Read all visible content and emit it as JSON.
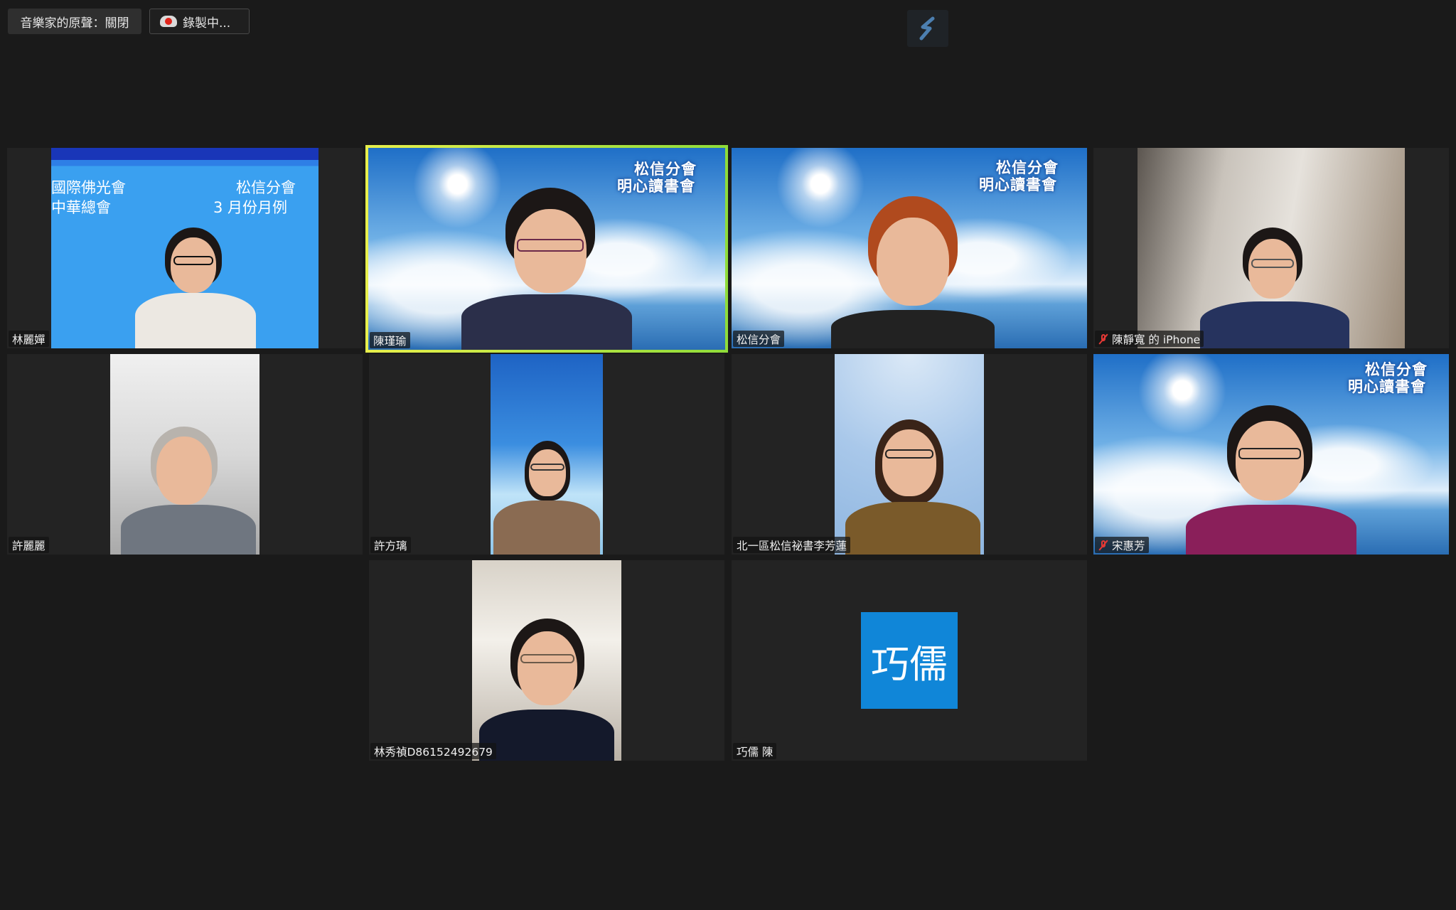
{
  "topbar": {
    "music_mode_label": "音樂家的原聲：關閉",
    "recording_label": "錄製中..."
  },
  "gallery": {
    "tiles": [
      {
        "name": "林麗嬋",
        "muted": false,
        "slide_lines": [
          "國際佛光會",
          "中華總會",
          "松信分會",
          "3 月份月例"
        ]
      },
      {
        "name": "陳瑾瑜",
        "muted": false,
        "active_speaker": true,
        "slide_lines": [
          "松信分會",
          "明心讀書會"
        ]
      },
      {
        "name": "松信分會",
        "muted": false,
        "slide_lines": [
          "松信分會",
          "明心讀書會"
        ]
      },
      {
        "name": "陳靜寬 的 iPhone",
        "muted": true
      },
      {
        "name": "許麗麗",
        "muted": false
      },
      {
        "name": "許方璃",
        "muted": false
      },
      {
        "name": "北一區松信祕書李芳蓮",
        "muted": false
      },
      {
        "name": "宋惠芳",
        "muted": true,
        "slide_lines": [
          "松信分會",
          "明心讀書會"
        ]
      },
      {
        "name": "林秀禎D86152492679",
        "muted": false
      },
      {
        "name": "巧儒 陳",
        "muted": false,
        "avatar_text": "巧儒"
      }
    ]
  },
  "colors": {
    "background": "#1a1a1a",
    "active_speaker_border": "#c6e84a",
    "avatar_blue": "#1086d8",
    "muted_red": "#e53935",
    "recording_red": "#e0241b"
  }
}
